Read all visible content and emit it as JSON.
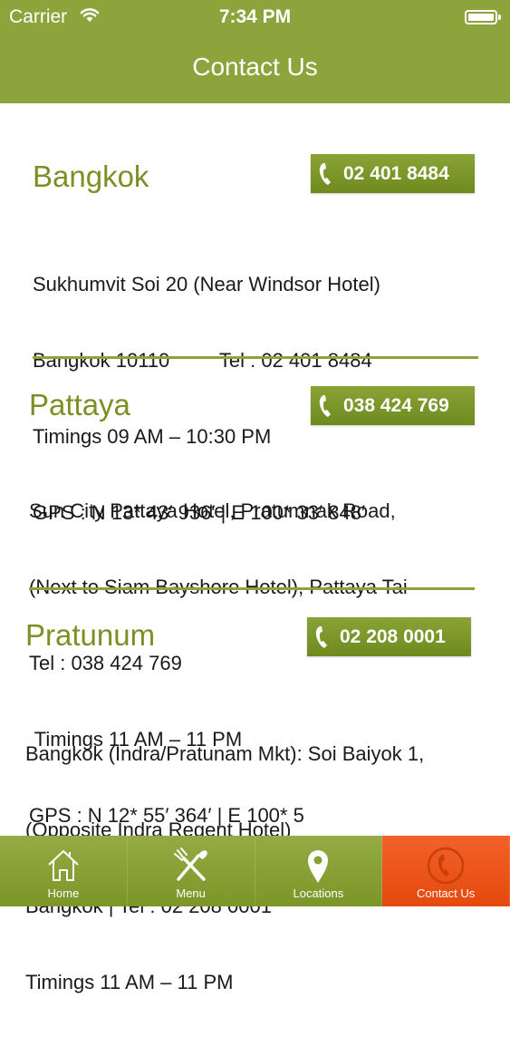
{
  "status_bar": {
    "carrier": "Carrier",
    "time": "7:34 PM"
  },
  "header": {
    "title": "Contact Us"
  },
  "locations": [
    {
      "city": "Bangkok",
      "phone_button": "02 401 8484",
      "lines": [
        "Sukhumvit Soi 20 (Near Windsor Hotel)",
        "Bangkok 10110         Tel : 02 401 8484",
        "Timings 09 AM – 10:30 PM",
        "GPS : N 13* 43′ 936′ | E 100* 33′ 848′"
      ]
    },
    {
      "city": "Pattaya",
      "phone_button": "038 424 769",
      "lines": [
        "Sun City Pattaya Hotel, Pratumnak Road,",
        "(Next to Siam Bayshore Hotel), Pattaya Tai",
        "Tel : 038 424 769",
        " Timings 11 AM – 11 PM",
        "GPS : N 12* 55′ 364′ | E 100* 5"
      ]
    },
    {
      "city": "Pratunum",
      "phone_button": "02 208 0001",
      "lines": [
        "Bangkok (Indra/Pratunam Mkt): Soi Baiyok 1,",
        "(Opposite Indra Regent Hotel)",
        "Bangkok | Tel : 02 208 0001",
        "Timings 11 AM – 11 PM"
      ]
    }
  ],
  "tabs": [
    {
      "label": "Home",
      "icon": "home-icon"
    },
    {
      "label": "Menu",
      "icon": "fork-knife-icon"
    },
    {
      "label": "Locations",
      "icon": "map-pin-icon"
    },
    {
      "label": "Contact Us",
      "icon": "phone-icon",
      "active": true
    }
  ],
  "colors": {
    "brand_green": "#8da43c",
    "active_tab": "#e5490c",
    "city_text": "#7c8f24"
  }
}
